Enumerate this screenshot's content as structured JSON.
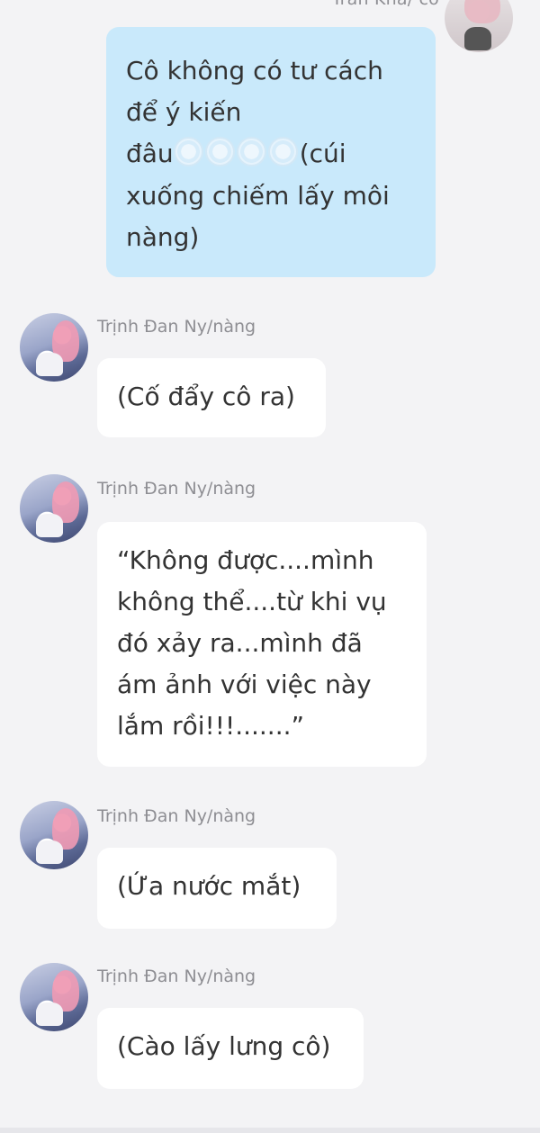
{
  "top_message": {
    "sender_name": "Trần Khả/ cô",
    "lines": [
      "Cô không có tư cách",
      "để ý kiến",
      "đâu",
      "(cúi",
      "xuống chiếm lấy môi",
      "nàng)"
    ],
    "emoji_icons": [
      "frozen-face-icon",
      "frozen-face-icon",
      "frozen-face-icon",
      "frozen-face-icon"
    ]
  },
  "messages": [
    {
      "sender_name": "Trịnh Đan Ny/nàng",
      "lines": [
        "(Cố đẩy cô ra)"
      ]
    },
    {
      "sender_name": "Trịnh Đan Ny/nàng",
      "lines": [
        "“Không được....mình",
        "không thể....từ khi vụ",
        "đó xảy ra...mình đã",
        "ám ảnh với việc này",
        "lắm rồi!!!.......”"
      ]
    },
    {
      "sender_name": "Trịnh Đan Ny/nàng",
      "lines": [
        "(Ứa nước mắt)"
      ]
    },
    {
      "sender_name": "Trịnh Đan Ny/nàng",
      "lines": [
        "(Cào lấy lưng cô)"
      ]
    }
  ],
  "colors": {
    "background": "#f3f3f5",
    "outgoing_bubble": "#c9e9fb",
    "incoming_bubble": "#ffffff",
    "name_text": "#8e8e93",
    "message_text": "#333333"
  }
}
